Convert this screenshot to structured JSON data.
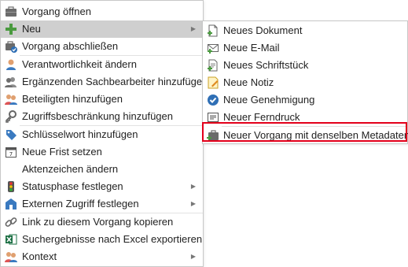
{
  "menu": {
    "items": [
      {
        "label": "Vorgang öffnen",
        "icon": "open-case-icon"
      },
      {
        "label": "Neu",
        "icon": "plus-icon"
      },
      {
        "label": "Vorgang abschließen",
        "icon": "close-case-icon"
      },
      {
        "label": "Verantwortlichkeit ändern",
        "icon": "person-icon"
      },
      {
        "label": "Ergänzenden Sachbearbeiter hinzufügen",
        "icon": "people-icon"
      },
      {
        "label": "Beteiligten hinzufügen",
        "icon": "participants-icon"
      },
      {
        "label": "Zugriffsbeschränkung hinzufügen",
        "icon": "key-icon"
      },
      {
        "label": "Schlüsselwort hinzufügen",
        "icon": "tag-icon"
      },
      {
        "label": "Neue Frist setzen",
        "icon": "calendar-icon"
      },
      {
        "label": "Aktenzeichen ändern",
        "icon": "file-number-icon"
      },
      {
        "label": "Statusphase festlegen",
        "icon": "traffic-light-icon"
      },
      {
        "label": "Externen Zugriff festlegen",
        "icon": "external-access-icon"
      },
      {
        "label": "Link zu diesem Vorgang kopieren",
        "icon": "link-icon"
      },
      {
        "label": "Suchergebnisse nach Excel exportieren",
        "icon": "excel-icon"
      },
      {
        "label": "Kontext",
        "icon": "context-icon"
      }
    ]
  },
  "submenu": {
    "items": [
      {
        "label": "Neues Dokument",
        "icon": "new-document-icon"
      },
      {
        "label": "Neue E-Mail",
        "icon": "new-email-icon"
      },
      {
        "label": "Neues Schriftstück",
        "icon": "new-letter-icon"
      },
      {
        "label": "Neue Notiz",
        "icon": "new-note-icon"
      },
      {
        "label": "Neue Genehmigung",
        "icon": "approval-icon"
      },
      {
        "label": "Neuer Ferndruck",
        "icon": "remote-print-icon"
      },
      {
        "label": "Neuer Vorgang mit denselben Metadaten",
        "icon": "new-case-metadata-icon"
      }
    ]
  },
  "colors": {
    "highlight": "#cfcfcf",
    "outline": "#e3001b"
  }
}
